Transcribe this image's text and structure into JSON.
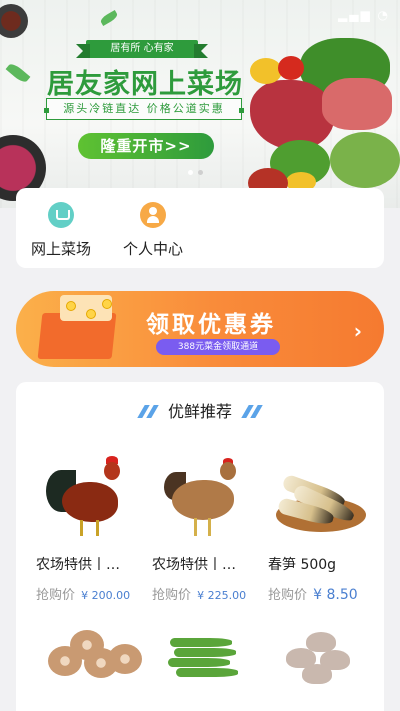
{
  "banner": {
    "ribbon": "居有所 心有家",
    "title": "居友家网上菜场",
    "subtitle": "源头冷链直达  价格公道实惠",
    "cta": "隆重开市>>",
    "dots": 2
  },
  "nav": {
    "items": [
      {
        "label": "网上菜场",
        "icon": "market-icon"
      },
      {
        "label": "个人中心",
        "icon": "user-icon"
      }
    ]
  },
  "coupon": {
    "title": "领取优惠券",
    "subtitle": "388元菜金领取通道",
    "arrow": "›"
  },
  "recommend": {
    "title": "优鲜推荐",
    "products": [
      {
        "name": "农场特供丨…",
        "price_label": "抢购价",
        "price": "¥ 200.00",
        "image": "rooster"
      },
      {
        "name": "农场特供丨…",
        "price_label": "抢购价",
        "price": "¥ 225.00",
        "image": "hen"
      },
      {
        "name": "春笋 500g",
        "price_label": "抢购价",
        "price": "¥ 8.50",
        "image": "bamboo-shoot"
      },
      {
        "image": "lotus-root"
      },
      {
        "image": "okra"
      },
      {
        "image": "mushroom"
      }
    ]
  },
  "colors": {
    "brand_green": "#2e9b3c",
    "coupon_orange": "#f98b3a",
    "price_blue": "#4a7fd0",
    "coupon_badge_purple": "#7a5cf0"
  }
}
